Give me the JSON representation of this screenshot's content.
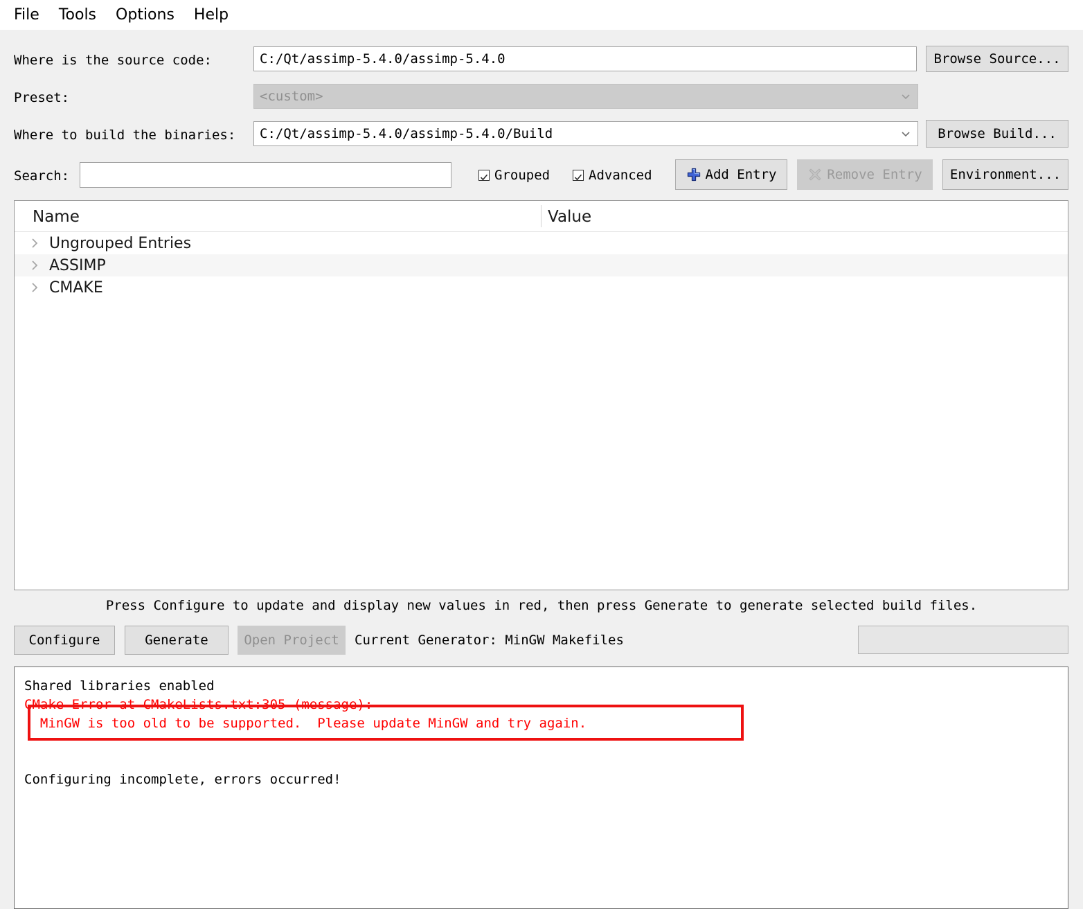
{
  "menu": {
    "items": [
      {
        "label": "File",
        "name": "menu-file"
      },
      {
        "label": "Tools",
        "name": "menu-tools"
      },
      {
        "label": "Options",
        "name": "menu-options"
      },
      {
        "label": "Help",
        "name": "menu-help"
      }
    ]
  },
  "form": {
    "source_label": "Where is the source code:",
    "source_value": "C:/Qt/assimp-5.4.0/assimp-5.4.0",
    "browse_source_label": "Browse Source...",
    "preset_label": "Preset:",
    "preset_value": "<custom>",
    "build_label": "Where to build the binaries:",
    "build_value": "C:/Qt/assimp-5.4.0/assimp-5.4.0/Build",
    "browse_build_label": "Browse Build..."
  },
  "toolbar": {
    "search_label": "Search:",
    "search_value": "",
    "search_placeholder": "",
    "grouped_label": "Grouped",
    "grouped_checked": true,
    "advanced_label": "Advanced",
    "advanced_checked": true,
    "add_entry_label": "Add Entry",
    "remove_entry_label": "Remove Entry",
    "remove_entry_enabled": false,
    "environment_label": "Environment..."
  },
  "tree": {
    "columns": [
      "Name",
      "Value"
    ],
    "rows": [
      {
        "name": "Ungrouped Entries",
        "value": "",
        "expanded": false
      },
      {
        "name": "ASSIMP",
        "value": "",
        "expanded": false
      },
      {
        "name": "CMAKE",
        "value": "",
        "expanded": false
      }
    ]
  },
  "hint": "Press Configure to update and display new values in red, then press Generate to generate selected build files.",
  "actions": {
    "configure_label": "Configure",
    "generate_label": "Generate",
    "open_project_label": "Open Project",
    "open_project_enabled": false,
    "current_generator_label": "Current Generator: MinGW Makefiles"
  },
  "log": {
    "lines": [
      {
        "text": "Shared libraries enabled",
        "error": false
      },
      {
        "text": "CMake Error at CMakeLists.txt:305 (message):",
        "error": true
      },
      {
        "text": "  MinGW is too old to be supported.  Please update MinGW and try again.",
        "error": true
      },
      {
        "text": "",
        "error": false
      },
      {
        "text": "",
        "error": false
      },
      {
        "text": "Configuring incomplete, errors occurred!",
        "error": false
      }
    ]
  },
  "annotation": {
    "color": "#ee1111",
    "target_text": "MinGW is too old to be supported.  Please update MinGW and try again."
  },
  "icons": {
    "add_entry": "plus-icon",
    "remove_entry": "cross-icon",
    "combo_arrow": "chevron-down-icon",
    "tree_expand": "chevron-right-icon",
    "checkbox_check": "check-icon"
  },
  "colors": {
    "window_bg": "#f0f0f0",
    "field_bg": "#ffffff",
    "button_bg": "#e1e1e1",
    "disabled_bg": "#cccccc",
    "error_text": "#ff0000",
    "accent_blue": "#2a4fc8"
  }
}
